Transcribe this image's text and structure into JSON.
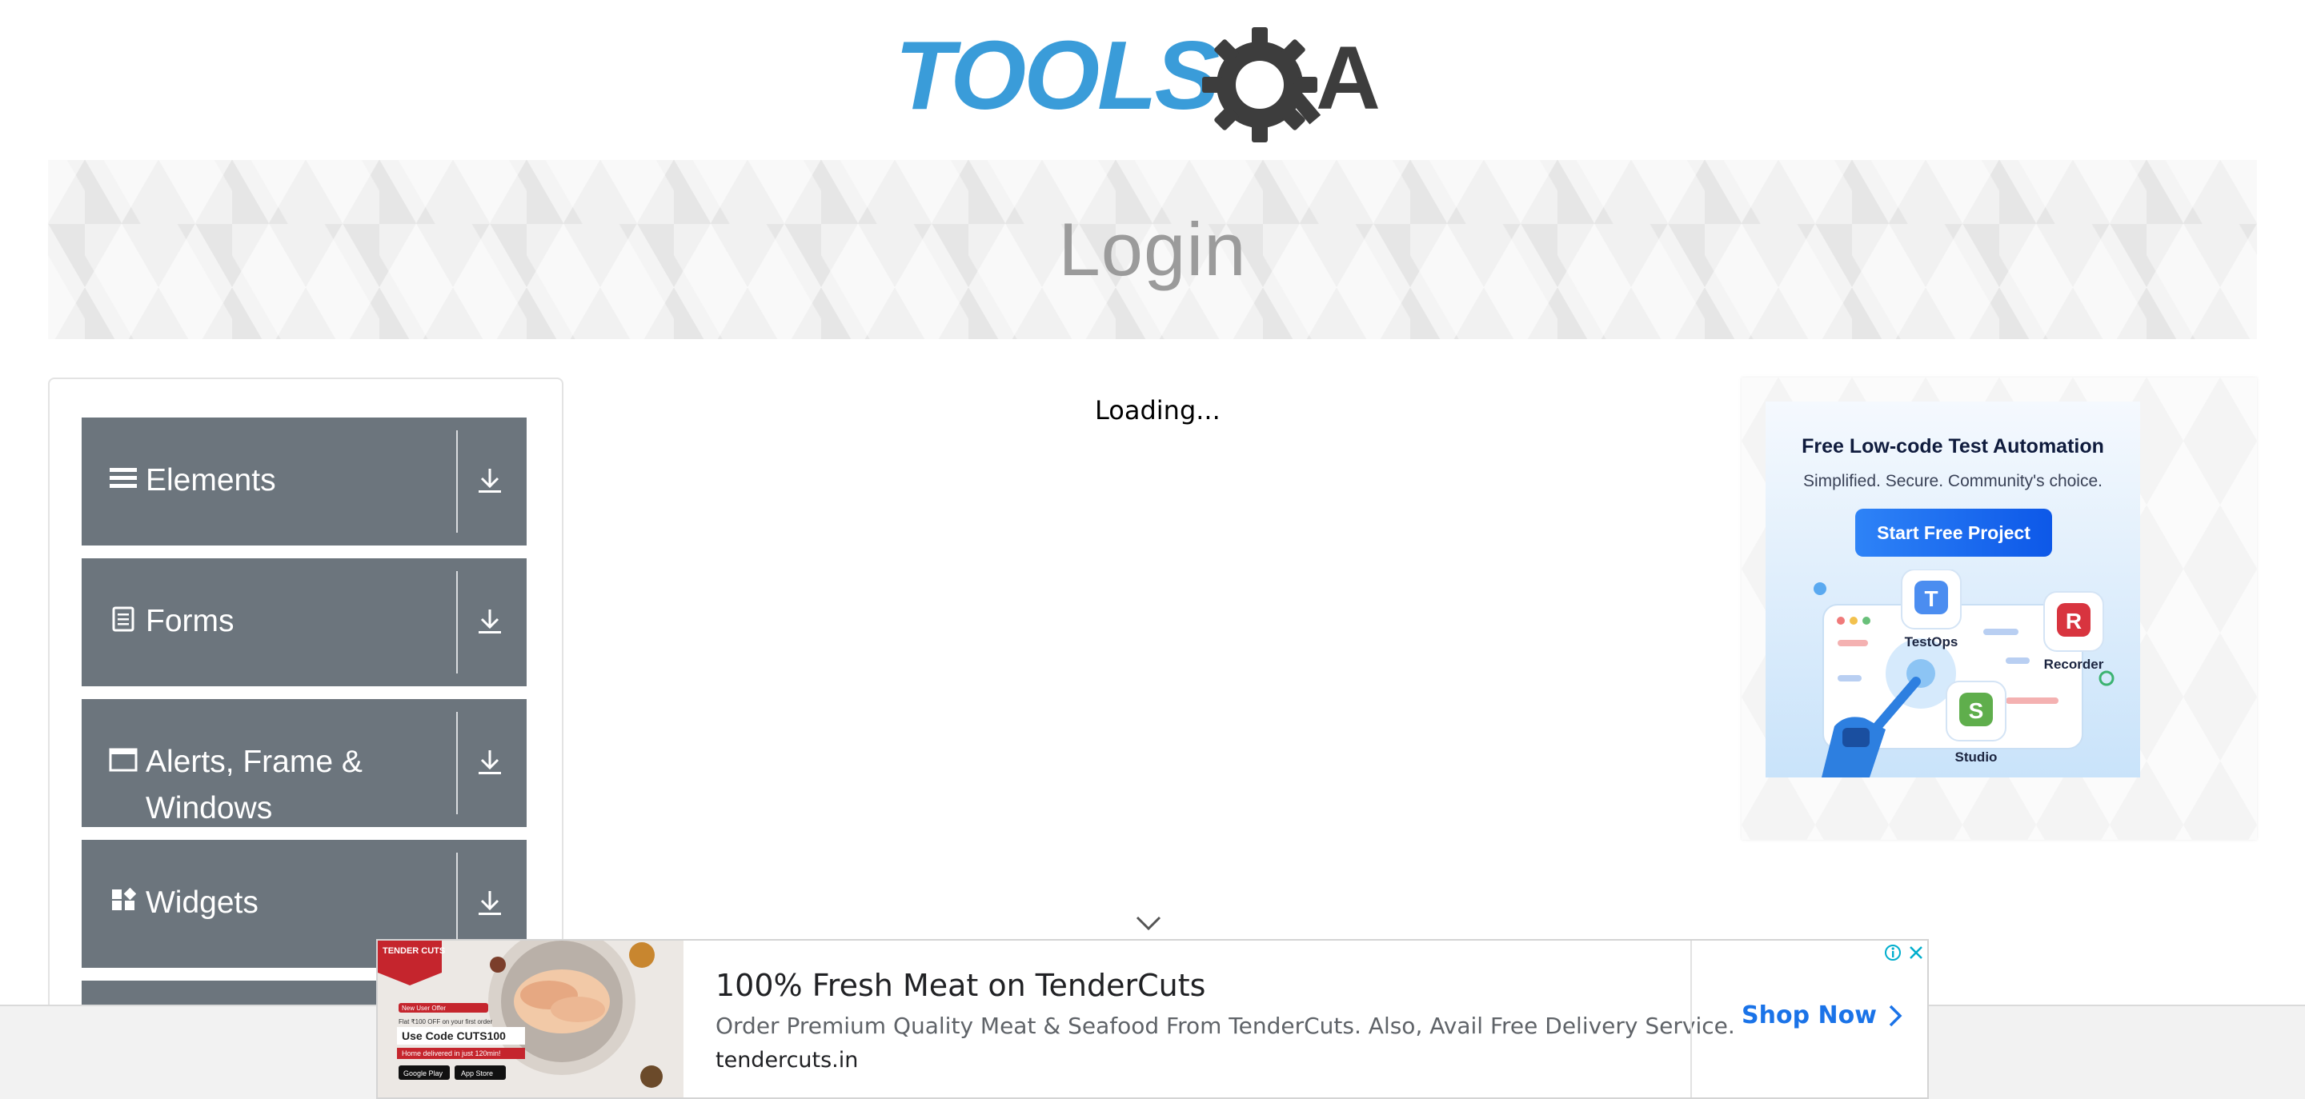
{
  "header": {
    "logo_text": "TOOLSQA",
    "logo_colors": {
      "tools": "#3a9cd9",
      "qa": "#3d3d3d"
    }
  },
  "banner": {
    "title": "Login"
  },
  "sidebar": {
    "groups": [
      {
        "label": "Elements",
        "icon": "hamburger-icon"
      },
      {
        "label": "Forms",
        "icon": "document-icon"
      },
      {
        "label": "Alerts, Frame & Windows",
        "icon": "window-icon"
      },
      {
        "label": "Widgets",
        "icon": "widgets-icon"
      }
    ],
    "header_color": "#6c757d"
  },
  "main": {
    "loading_text": "Loading..."
  },
  "right_ad": {
    "title": "Free Low-code Test Automation",
    "subtitle": "Simplified. Secure. Community's choice.",
    "button": "Start Free Project",
    "apps": [
      {
        "label": "TestOps",
        "letter": "T"
      },
      {
        "label": "Recorder",
        "letter": "R"
      },
      {
        "label": "Studio",
        "letter": "S"
      }
    ]
  },
  "bottom_ad": {
    "title": "100% Fresh Meat on TenderCuts",
    "description": "Order Premium Quality Meat & Seafood From TenderCuts. Also, Avail Free Delivery Service.",
    "domain": "tendercuts.in",
    "cta": "Shop Now",
    "image_text": {
      "brand": "TENDER CUTS",
      "offer": "New User Offer",
      "flat": "Flat ₹100 OFF on your first order",
      "code": "Use Code CUTS100",
      "delivery": "Home delivered in just 120min!",
      "google_play": "Google Play",
      "app_store": "App Store"
    },
    "accent": "#1a73e8"
  }
}
